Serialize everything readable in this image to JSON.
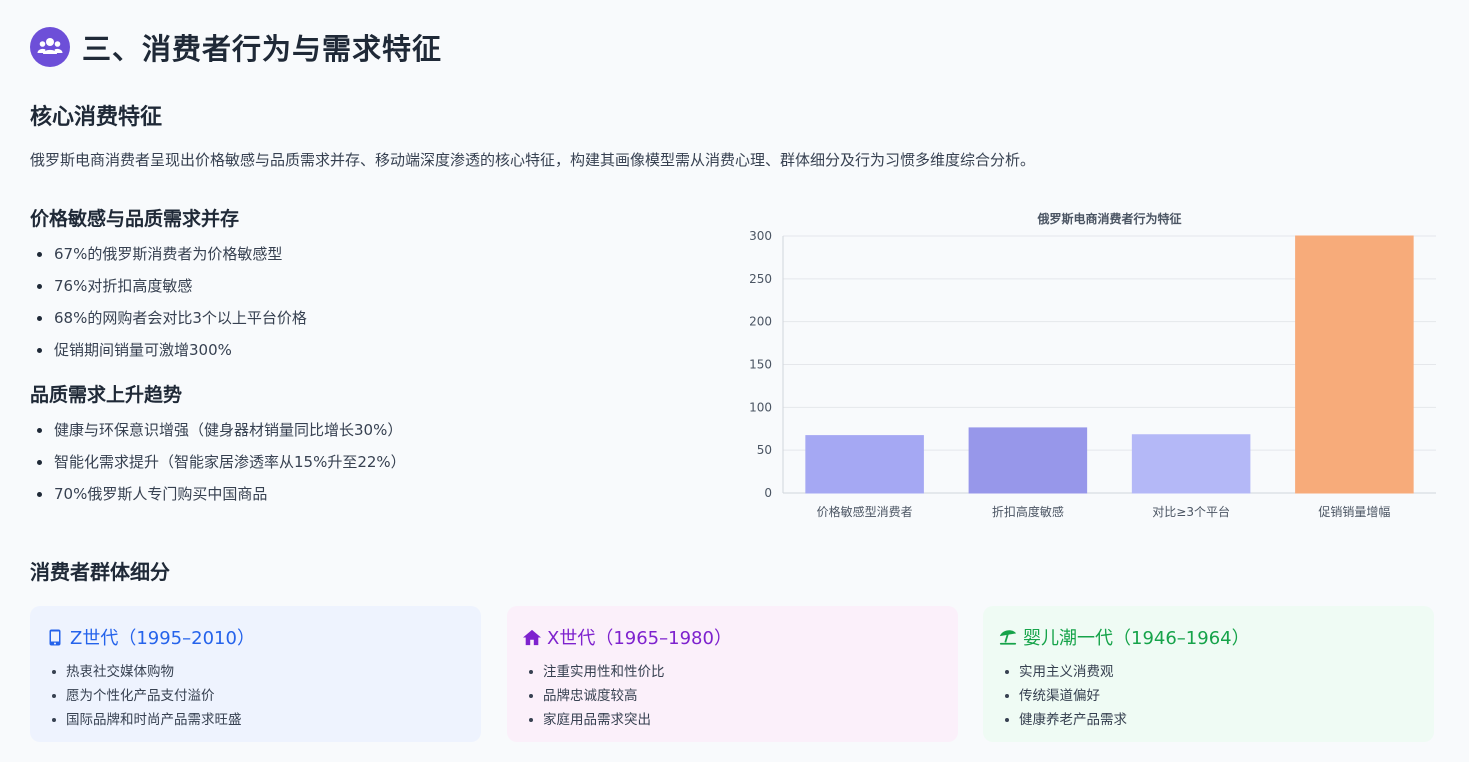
{
  "header": {
    "title": "三、消费者行为与需求特征",
    "icon": "users-icon",
    "icon_color": "#6d4fd8"
  },
  "core": {
    "heading": "核心消费特征",
    "intro": "俄罗斯电商消费者呈现出价格敏感与品质需求并存、移动端深度渗透的核心特征，构建其画像模型需从消费心理、群体细分及行为习惯多维度综合分析。"
  },
  "price": {
    "heading": "价格敏感与品质需求并存",
    "items": [
      "67%的俄罗斯消费者为价格敏感型",
      "76%对折扣高度敏感",
      "68%的网购者会对比3个以上平台价格",
      "促销期间销量可激增300%"
    ]
  },
  "quality": {
    "heading": "品质需求上升趋势",
    "items": [
      "健康与环保意识增强（健身器材销量同比增长30%）",
      "智能化需求提升（智能家居渗透率从15%升至22%）",
      "70%俄罗斯人专门购买中国商品"
    ]
  },
  "chart_data": {
    "type": "bar",
    "title": "俄罗斯电商消费者行为特征",
    "categories": [
      "价格敏感型消费者",
      "折扣高度敏感",
      "对比≥3个平台",
      "促销销量增幅"
    ],
    "values": [
      67,
      76,
      68,
      300
    ],
    "colors": [
      "#a5a8f3",
      "#9797ea",
      "#b4b8f7",
      "#f7ab7a"
    ],
    "ylim": [
      0,
      300
    ],
    "yticks": [
      0,
      50,
      100,
      150,
      200,
      250,
      300
    ],
    "grid": true,
    "xlabel": "",
    "ylabel": ""
  },
  "segments": {
    "heading": "消费者群体细分",
    "cards": [
      {
        "title": "Z世代（1995–2010）",
        "icon": "mobile-phone-icon",
        "color": "#2563eb",
        "items": [
          "热衷社交媒体购物",
          "愿为个性化产品支付溢价",
          "国际品牌和时尚产品需求旺盛"
        ]
      },
      {
        "title": "X世代（1965–1980）",
        "icon": "home-icon",
        "color": "#7e22ce",
        "items": [
          "注重实用性和性价比",
          "品牌忠诚度较高",
          "家庭用品需求突出"
        ]
      },
      {
        "title": "婴儿潮一代（1946–1964）",
        "icon": "beach-umbrella-icon",
        "color": "#16a34a",
        "items": [
          "实用主义消费观",
          "传统渠道偏好",
          "健康养老产品需求"
        ]
      }
    ]
  }
}
